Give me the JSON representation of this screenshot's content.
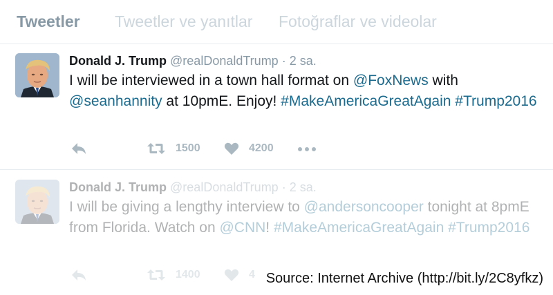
{
  "tabs": [
    {
      "label": "Tweetler",
      "active": true
    },
    {
      "label": "Tweetler ve yanıtlar",
      "active": false
    },
    {
      "label": "Fotoğraflar ve videolar",
      "active": false
    }
  ],
  "tweets": [
    {
      "name": "Donald J. Trump",
      "handle": "@realDonaldTrump",
      "separator": "·",
      "time": "2 sa.",
      "text_parts": {
        "p1": "I will be interviewed in a town hall format on ",
        "m1": "@FoxNews",
        "p2": " with ",
        "m2": "@seanhannity",
        "p3": " at 10pmE. Enjoy! ",
        "h1": "#MakeAmericaGreatAgain",
        "p4": " ",
        "h2": "#Trump2016"
      },
      "retweets": "1500",
      "likes": "4200"
    },
    {
      "name": "Donald J. Trump",
      "handle": "@realDonaldTrump",
      "separator": "·",
      "time": "2 sa.",
      "text_parts": {
        "p1": "I will be giving a lengthy interview to ",
        "m1": "@andersoncooper",
        "p2": " tonight at 8pmE from Florida. Watch on ",
        "m2": "@CNN",
        "p3": "! ",
        "h1": "#MakeAmericaGreatAgain",
        "p4": " ",
        "h2": "#Trump2016"
      },
      "retweets": "1400",
      "likes": "4"
    }
  ],
  "source_note": "Source: Internet Archive (http://bit.ly/2C8yfkz)",
  "icons": {
    "reply": "reply-icon",
    "retweet": "retweet-icon",
    "like": "heart-icon",
    "more": "more-dots-icon"
  },
  "colors": {
    "link": "#1b6b8f",
    "muted": "#8899a6",
    "action": "#aab8c2",
    "text": "#14171a"
  }
}
